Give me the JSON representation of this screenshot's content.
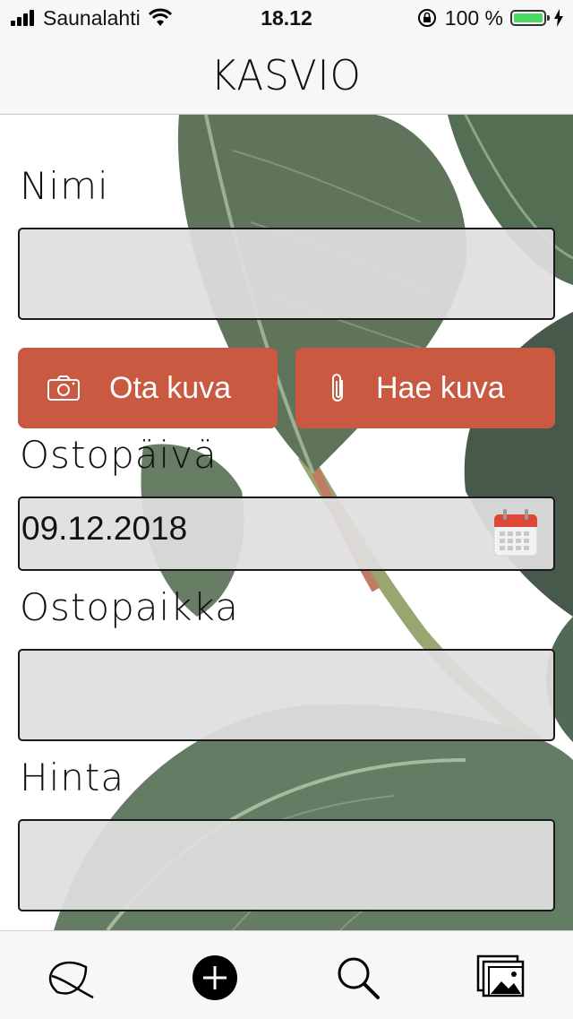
{
  "status_bar": {
    "carrier": "Saunalahti",
    "time": "18.12",
    "battery": "100 %",
    "battery_color": "#4cd964"
  },
  "header": {
    "title": "KASVIO"
  },
  "form": {
    "name_label": "Nimi",
    "name_value": "",
    "take_photo_label": "Ota kuva",
    "fetch_photo_label": "Hae kuva",
    "purchase_date_label": "Ostopäivä",
    "purchase_date_value": "09.12.2018",
    "purchase_place_label": "Ostopaikka",
    "purchase_place_value": "",
    "price_label": "Hinta",
    "price_value": ""
  },
  "colors": {
    "accent": "#c95941",
    "field_bg": "#dfdfdf",
    "bar_bg": "#f7f7f7"
  },
  "tab_bar": {
    "items": [
      {
        "icon": "leaf-icon",
        "active": false
      },
      {
        "icon": "add-circle-icon",
        "active": true
      },
      {
        "icon": "search-icon",
        "active": false
      },
      {
        "icon": "photos-icon",
        "active": false
      }
    ]
  }
}
